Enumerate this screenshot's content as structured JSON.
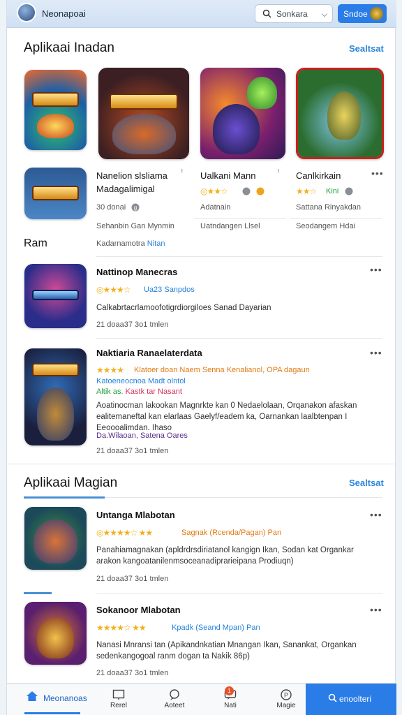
{
  "header": {
    "app_name": "Nеonapoai",
    "search_placeholder": "Sonkara",
    "action_label": "Sndoe"
  },
  "section1": {
    "title": "Aplikaai Inadan",
    "link": "Sealtsat",
    "row_label": "Ram",
    "row_sub": "Kadarnamotra",
    "row_sub_link": "Nitan",
    "cards": [
      {
        "title": "Nanelion slsliama",
        "subtitle": "Madagalimigal",
        "rating_text": "30 donai",
        "dev": "Sehanbin Gan Mynmin"
      },
      {
        "title": "Ualkani Mann",
        "rating_text": "Adatnain",
        "dev": "Uatndangen Llsel"
      },
      {
        "title": "Canlkirkain",
        "rating_text": "Kini",
        "dev": "Sattana Rinyakdan",
        "dev2": "Seodangem Hdai"
      }
    ]
  },
  "list1": [
    {
      "title": "Nattinop Manecras",
      "rating_text": "Ua23 Sanpdos",
      "desc": "Calkabrtacrlamoofotigrdiorgiloes Sanad Dayarian",
      "meta": "21 doaa37 3o1 tmlen"
    },
    {
      "title": "Naktiaria Ranaelaterdata",
      "rating_line": "Klatoer doan Naem  Senna Kenalianol, OPA dagaun",
      "tag1": "Katoeneocnoa Madt olntol",
      "tag2a": "Altik as.",
      "tag2b": "Kastk  tar Nasant",
      "desc": "Aoatinocman lakookan Magnrkte kan 0 Nedaelolaan, Orqanakon afaskan ealitemaneftal kan elarlaas Gaelyf/eadem ka, Oarnankan laalbtenpan I Eeoooalimdan. Ihaso",
      "link": "Da.Wilaoan, Satena Oares",
      "meta": "21 doaa37 3o1 tmlen"
    }
  ],
  "section2": {
    "title": "Aplikaai Magian",
    "link": "Sealtsat"
  },
  "list2": [
    {
      "title": "Untanga Mlabotan",
      "rating_text": "Sagnak (Rcenda/Pagan) Pan",
      "desc": "Panahiamagnakan (apldrdrsdiriatanol kangign Ikan, Sodan kat Organkar arakon kangoatanilenmsoceanadiprarieipana Prodiuqn)",
      "meta": "21 doaa37 3o1 tmlen"
    },
    {
      "title": "Sokanoor Mlabotan",
      "rating_text": "Kpadk (Seand Mpan) Pan",
      "desc": "Nanasi Mnransi tan (Apikandnkatian Mnangan Ikan, Sanankat, Organkan sedenkangogoal ranm dogan ta Nakik 86p)",
      "meta": "21 doaa37 3o1 tmlen"
    }
  ],
  "bottom_nav": {
    "home": "Meonanoas",
    "item2": "Rerel",
    "item3": "Aoteet",
    "item4": "Nati",
    "item4_badge": "1",
    "item5": "Magie",
    "cta": "enoolteri"
  }
}
